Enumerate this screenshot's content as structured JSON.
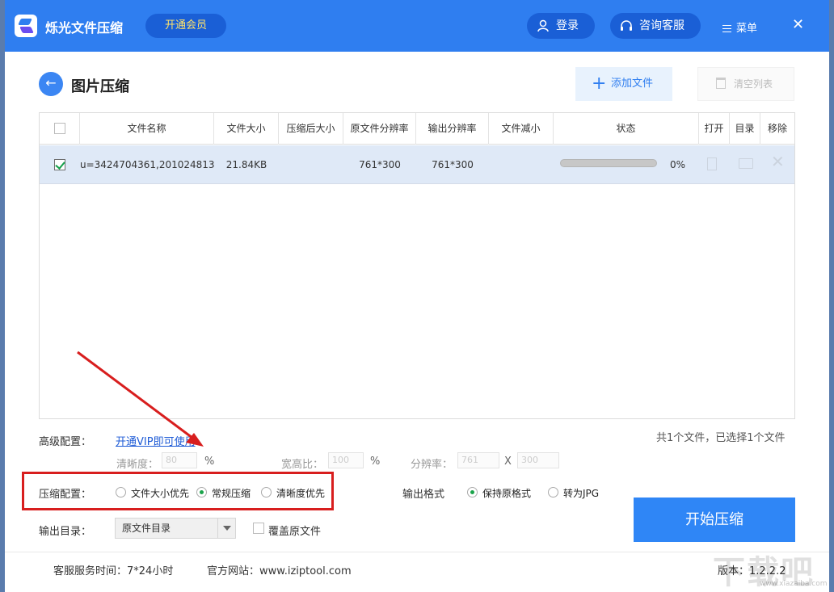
{
  "titlebar": {
    "app_title": "烁光文件压缩",
    "vip_label": "开通会员",
    "login_label": "登录",
    "service_label": "咨询客服",
    "menu_label": "菜单",
    "close_glyph": "✕"
  },
  "header": {
    "back_glyph": "←",
    "page_title": "图片压缩",
    "add_label": "添加文件",
    "clear_label": "清空列表"
  },
  "table": {
    "columns": [
      "文件名称",
      "文件大小",
      "压缩后大小",
      "原文件分辨率",
      "输出分辨率",
      "文件减小",
      "状态",
      "打开",
      "目录",
      "移除"
    ],
    "rows": [
      {
        "checked": true,
        "name": "u=3424704361,201024813...",
        "size": "21.84KB",
        "compressed_size": "",
        "orig_resolution": "761*300",
        "out_resolution": "761*300",
        "reduced": "",
        "progress": 0,
        "progress_label": "0%"
      }
    ]
  },
  "advanced": {
    "label": "高级配置：",
    "vip_link": "开通VIP即可使用",
    "count_text": "共1个文件，已选择1个文件",
    "clarity_label": "清晰度：",
    "clarity_value": "80",
    "clarity_unit": "%",
    "ratio_label": "宽高比：",
    "ratio_value": "100",
    "ratio_unit": "%",
    "resolution_label": "分辨率：",
    "res_w": "761",
    "res_x": "X",
    "res_h": "300"
  },
  "compress": {
    "label": "压缩配置：",
    "options": [
      "文件大小优先",
      "常规压缩",
      "清晰度优先"
    ],
    "selected": 1
  },
  "format": {
    "label": "输出格式",
    "options": [
      "保持原格式",
      "转为JPG"
    ],
    "selected": 0
  },
  "output": {
    "label": "输出目录：",
    "value": "原文件目录",
    "overwrite_label": "覆盖原文件"
  },
  "start_label": "开始压缩",
  "footer": {
    "service_hours": "客服服务时间：7*24小时",
    "website": "官方网站：www.iziptool.com",
    "version": "版本：1.2.2.2"
  },
  "watermark": {
    "text": "下载吧",
    "url": "www.xiazaiba.com"
  },
  "colors": {
    "accent": "#2f7ef0",
    "annotation": "#d81e1e",
    "selected_radio": "#1aa34a"
  }
}
